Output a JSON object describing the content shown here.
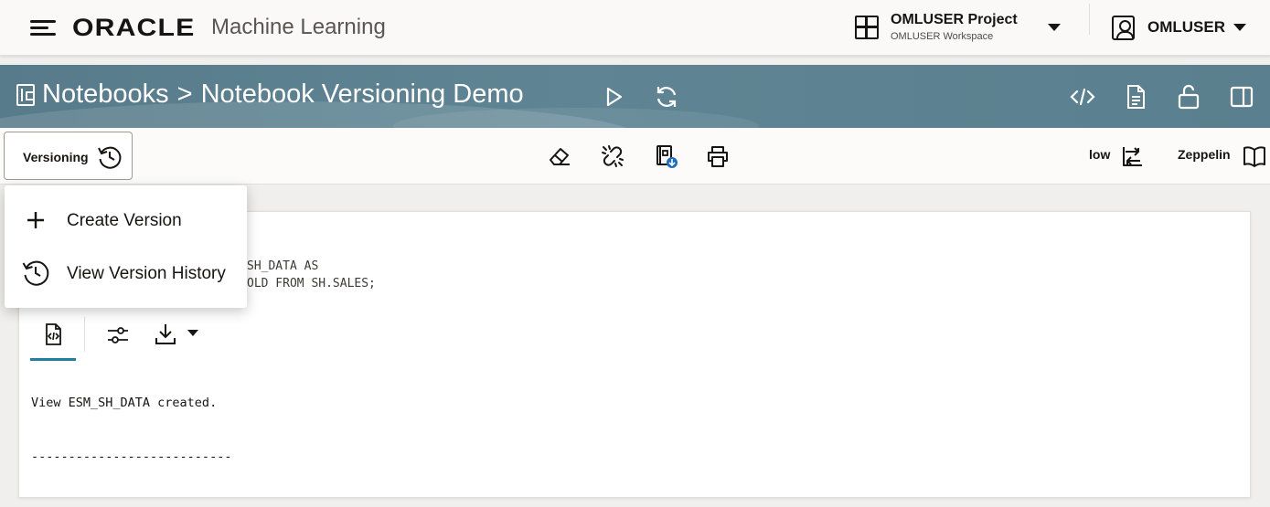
{
  "header": {
    "brand": "ORACLE",
    "product": "Machine Learning",
    "project_name": "OMLUSER Project",
    "workspace_name": "OMLUSER Workspace",
    "user_name": "OMLUSER"
  },
  "banner": {
    "breadcrumb_root": "Notebooks",
    "separator": ">",
    "notebook_title": "Notebook Versioning Demo",
    "icons": [
      "run-icon",
      "refresh-icon",
      "code-view-icon",
      "document-icon",
      "unlock-icon",
      "panel-icon"
    ]
  },
  "toolbar": {
    "versioning_label": "Versioning",
    "connection_label": "low",
    "interpreter_label": "Zeppelin",
    "icons": [
      "eraser-icon",
      "unlink-icon",
      "export-notebook-icon",
      "print-icon",
      "switch-icon",
      "book-icon"
    ]
  },
  "versioning_menu": {
    "items": [
      {
        "label": "Create Version",
        "icon": "plus-icon"
      },
      {
        "label": "View Version History",
        "icon": "history-icon"
      }
    ]
  },
  "paragraph": {
    "code_lines": [
      "SH_DATA AS",
      "OLD FROM SH.SALES;"
    ],
    "output_tabs": [
      "code-output-icon",
      "settings-sliders-icon",
      "download-icon"
    ],
    "output_message": "View ESM_SH_DATA created.",
    "output_separator": "---------------------------"
  },
  "colors": {
    "banner": "#5f8594",
    "accent": "#227e9e",
    "badge_blue": "#1a6fc2"
  }
}
